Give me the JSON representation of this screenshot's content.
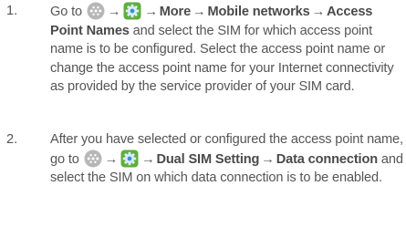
{
  "steps": [
    {
      "number": "1.",
      "go_to": "Go to",
      "arrow": "→",
      "bold1": "More",
      "bold2": "Mobile networks",
      "bold3": "Access Point Names",
      "text_after": " and select the SIM for which access point name is to be configured. Select the access point name or change the access point name for your Internet connectivity as provided by the service provider of your SIM card."
    },
    {
      "number": "2.",
      "text_before": "After you have selected or configured the access point name, go to",
      "arrow": "→",
      "bold1": "Dual SIM Setting",
      "bold2": "Data connection",
      "text_after": " and select the SIM on which data connection is to be enabled."
    }
  ],
  "icons": {
    "apps": "apps-drawer-icon",
    "settings": "settings-gear-icon"
  },
  "colors": {
    "text": "#555555",
    "apps_icon": "#b7b7b7",
    "settings_icon": "#5fae3a"
  }
}
